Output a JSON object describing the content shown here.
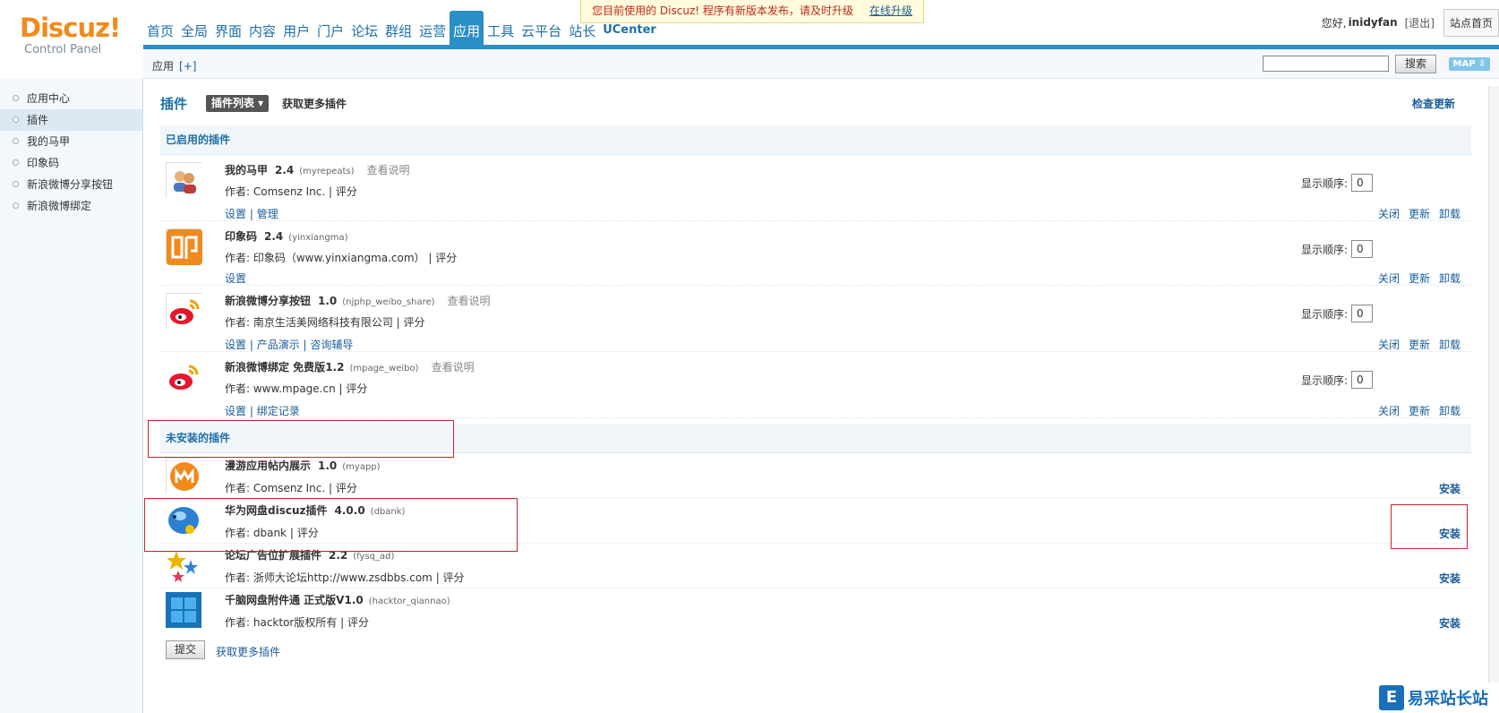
{
  "header": {
    "logo_brand": "Discuz!",
    "logo_sub": "Control Panel",
    "nav": [
      "首页",
      "全局",
      "界面",
      "内容",
      "用户",
      "门户",
      "论坛",
      "群组",
      "运营",
      "应用",
      "工具",
      "云平台",
      "站长",
      "UCenter"
    ],
    "active_nav": "应用",
    "notice_text": "您目前使用的 Discuz! 程序有新版本发布，请及时升级",
    "notice_link": "在线升级",
    "greeting": "您好,",
    "username": "inidyfan",
    "logout": "[退出]",
    "site_home": "站点首页"
  },
  "subbar": {
    "crumb": "应用",
    "crumb_add": "[+]",
    "search_button": "搜索",
    "map_button": "MAP ⇩"
  },
  "sidebar": {
    "items": [
      "应用中心",
      "插件",
      "我的马甲",
      "印象码",
      "新浪微博分享按钮",
      "新浪微博绑定"
    ],
    "active": "插件"
  },
  "main": {
    "title": "插件",
    "plugin_list_button": "插件列表 ▾",
    "get_more_top": "获取更多插件",
    "check_updates": "检查更新",
    "enabled_section": "已启用的插件",
    "uninstalled_section": "未安装的插件",
    "order_label": "显示顺序:",
    "enabled_plugins": [
      {
        "name": "我的马甲",
        "version": "2.4",
        "ident": "(myrepeats)",
        "readme": "查看说明",
        "author": "作者: Comsenz Inc. | ",
        "rate": "评分",
        "links": [
          "设置",
          "管理"
        ],
        "order": "0",
        "actions": [
          "关闭",
          "更新",
          "卸载"
        ]
      },
      {
        "name": "印象码",
        "version": "2.4",
        "ident": "(yinxiangma)",
        "readme": "",
        "author": "作者: 印象码（www.yinxiangma.com） | ",
        "rate": "评分",
        "links": [
          "设置"
        ],
        "order": "0",
        "actions": [
          "关闭",
          "更新",
          "卸载"
        ]
      },
      {
        "name": "新浪微博分享按钮",
        "version": "1.0",
        "ident": "(njphp_weibo_share)",
        "readme": "查看说明",
        "author": "作者: 南京生活美网络科技有限公司 | ",
        "rate": "评分",
        "links": [
          "设置",
          "产品演示",
          "咨询辅导"
        ],
        "order": "0",
        "actions": [
          "关闭",
          "更新",
          "卸载"
        ]
      },
      {
        "name": "新浪微博绑定 免费版",
        "version": "1.2",
        "ident": "(mpage_weibo)",
        "readme": "查看说明",
        "author": "作者: www.mpage.cn | ",
        "rate": "评分",
        "links": [
          "设置",
          "绑定记录"
        ],
        "order": "0",
        "actions": [
          "关闭",
          "更新",
          "卸载"
        ]
      }
    ],
    "uninstalled_plugins": [
      {
        "name": "漫游应用帖内展示",
        "version": "1.0",
        "ident": "(myapp)",
        "author": "作者: Comsenz Inc. | ",
        "rate": "评分",
        "install": "安装"
      },
      {
        "name": "华为网盘discuz插件",
        "version": "4.0.0",
        "ident": "(dbank)",
        "author": "作者: dbank | ",
        "rate": "评分",
        "install": "安装"
      },
      {
        "name": "论坛广告位扩展插件",
        "version": "2.2",
        "ident": "(fysq_ad)",
        "author": "作者: 浙师大论坛http://www.zsdbbs.com | ",
        "rate": "评分",
        "install": "安装"
      },
      {
        "name": "千脑网盘附件通 正式版V1.0",
        "version": "",
        "ident": "(hacktor_qiannao)",
        "author": "作者: hacktor版权所有 | ",
        "rate": "评分",
        "install": "安装"
      }
    ],
    "submit_button": "提交",
    "get_more_bottom": "获取更多插件"
  },
  "watermark": {
    "logo": "E",
    "text": "易采站长站"
  },
  "colors": {
    "brand_orange": "#f08a1c",
    "nav_blue": "#2a8fc4",
    "link_blue": "#1a5d99",
    "highlight_red": "#c0282c"
  }
}
